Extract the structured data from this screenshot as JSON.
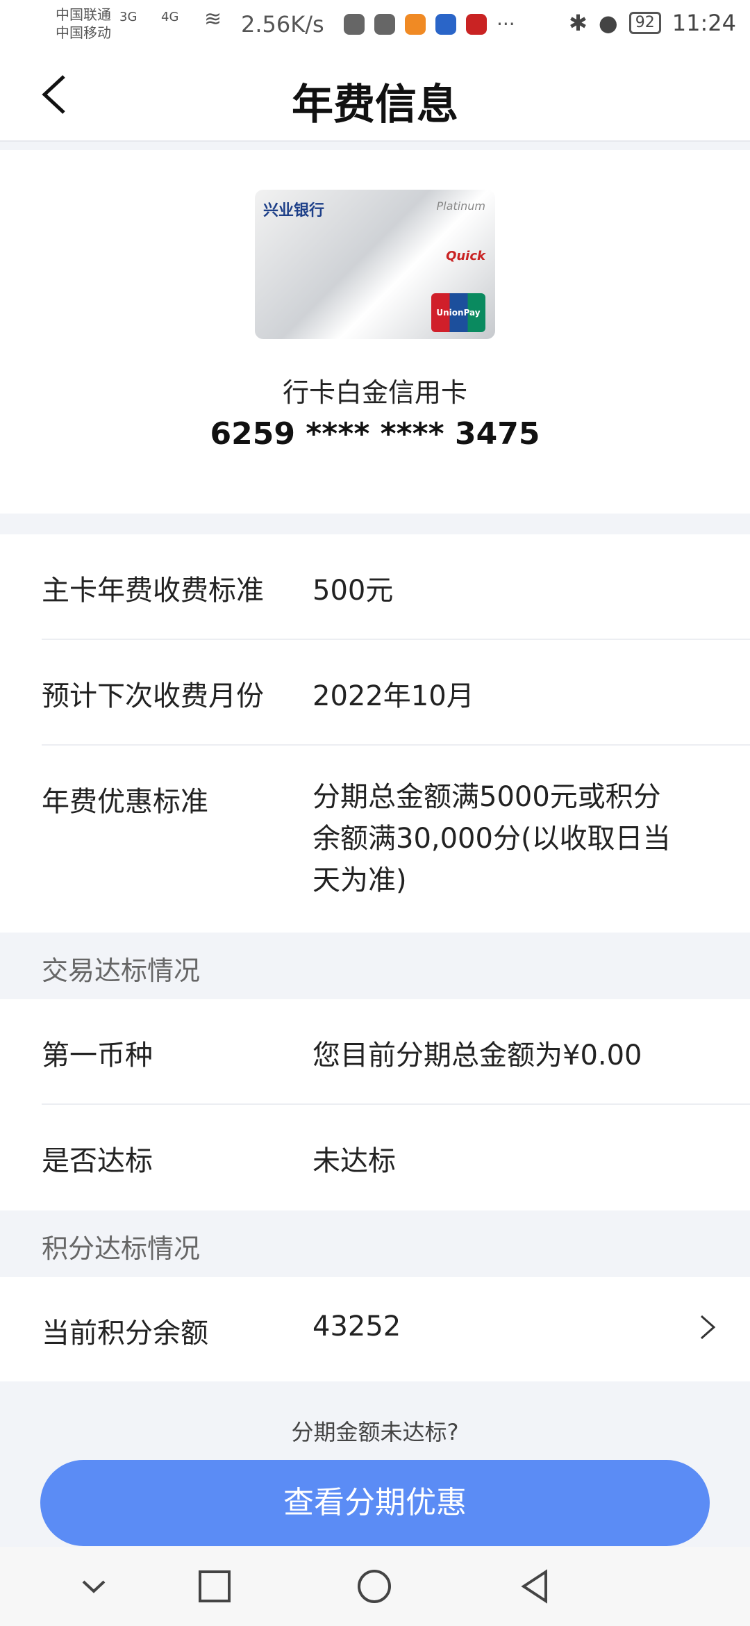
{
  "status_bar": {
    "carrier_1": "中国联通",
    "carrier_2": "中国移动",
    "signal_1": "3G",
    "signal_2": "4G",
    "network_speed": "2.56K/s",
    "more": "···",
    "battery": "92",
    "time": "11:24"
  },
  "header": {
    "title": "年费信息"
  },
  "card": {
    "bank_name": "兴业银行",
    "tier": "Platinum",
    "quickpass": "Quick",
    "unionpay": "UnionPay 银联",
    "name": "行卡白金信用卡",
    "number": "6259 **** **** 3475"
  },
  "fee_info": {
    "rows": [
      {
        "label": "主卡年费收费标准",
        "value": "500元"
      },
      {
        "label": "预计下次收费月份",
        "value": "2022年10月"
      },
      {
        "label": "年费优惠标准",
        "value_lines": [
          "分期总金额满5000元或积分",
          "余额满30,000分(以收取日当",
          "天为准)"
        ]
      }
    ]
  },
  "transaction_section": {
    "header": "交易达标情况",
    "rows": [
      {
        "label": "第一币种",
        "value": "您目前分期总金额为¥0.00"
      },
      {
        "label": "是否达标",
        "value": "未达标"
      }
    ]
  },
  "points_section": {
    "header": "积分达标情况",
    "rows": [
      {
        "label": "当前积分余额",
        "value": "43252"
      }
    ]
  },
  "footer": {
    "hint": "分期金额未达标?",
    "cta_label": "查看分期优惠"
  },
  "colors": {
    "accent": "#5b8cf5",
    "page_bg": "#f2f4f8"
  },
  "icons": {
    "back": "back-arrow-icon",
    "chevron": "chevron-right-icon",
    "nav_back": "nav-back-icon",
    "nav_home": "nav-home-icon",
    "nav_recents": "nav-recents-icon",
    "nav_collapse": "nav-collapse-icon"
  }
}
